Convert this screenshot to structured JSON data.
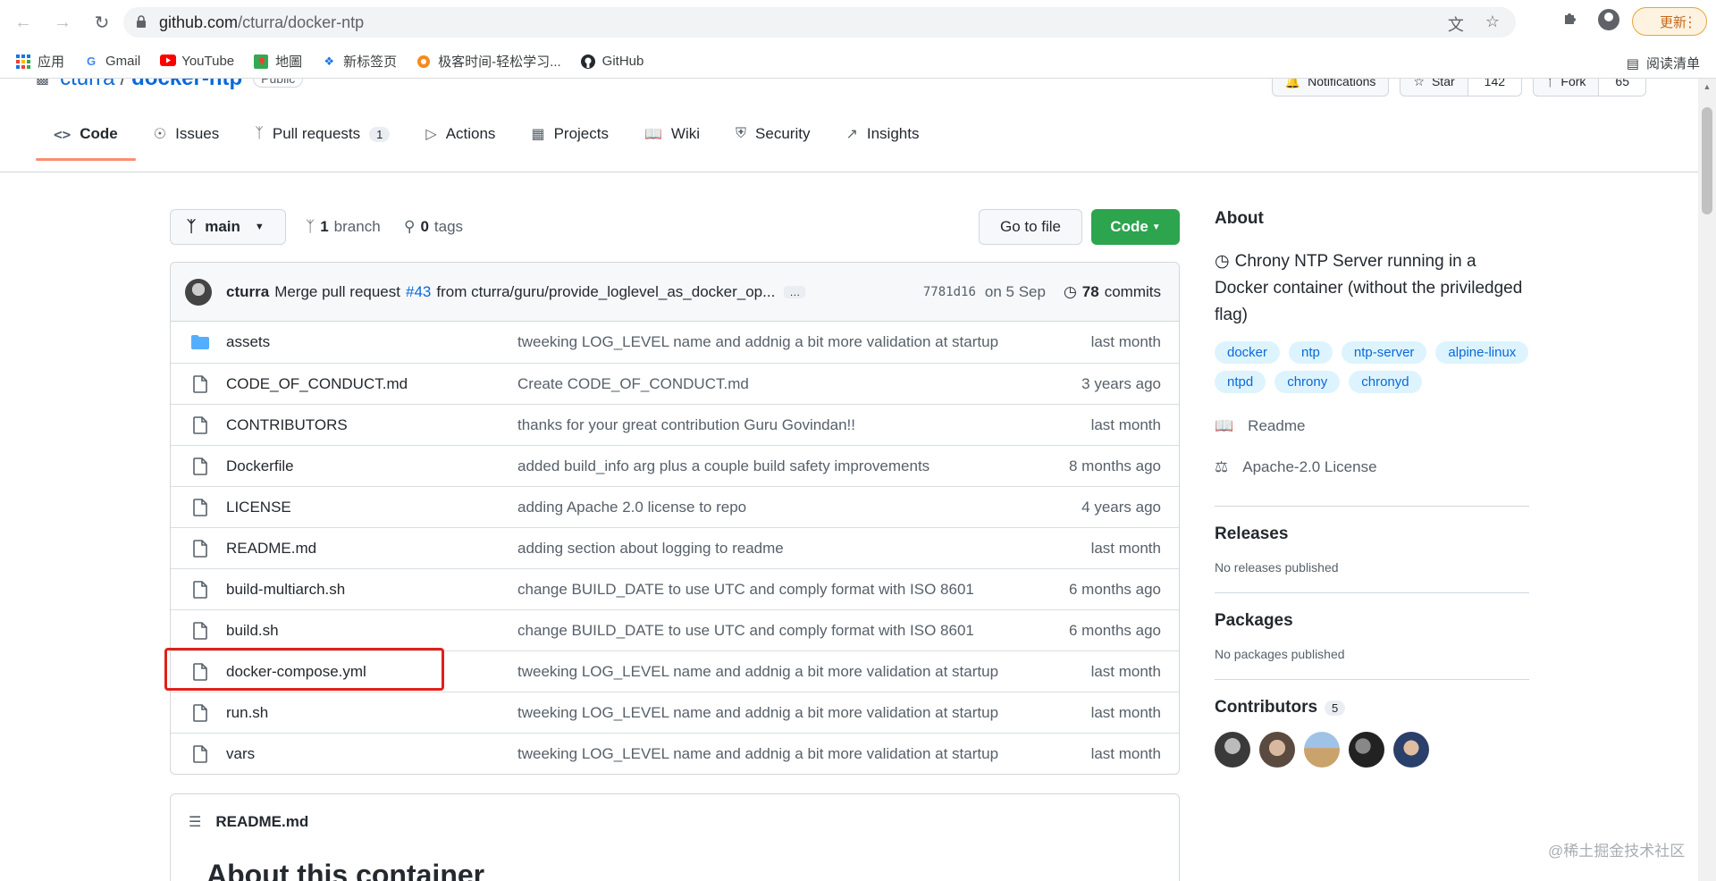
{
  "browser": {
    "url_host": "github.com",
    "url_path": "/cturra/docker-ntp",
    "update_label": "更新",
    "reading_list_label": "阅读清单",
    "bookmarks": [
      {
        "label": "应用",
        "icon": "apps-grid-icon"
      },
      {
        "label": "Gmail",
        "icon": "google-icon"
      },
      {
        "label": "YouTube",
        "icon": "youtube-icon"
      },
      {
        "label": "地圖",
        "icon": "maps-icon"
      },
      {
        "label": "新标签页",
        "icon": "new-tab-icon"
      },
      {
        "label": "极客时间-轻松学习...",
        "icon": "geektime-icon"
      },
      {
        "label": "GitHub",
        "icon": "github-icon"
      }
    ]
  },
  "repo": {
    "owner": "cturra",
    "separator": "/",
    "name": "docker-ntp",
    "visibility": "Public",
    "notifications_label": "Notifications",
    "star_label": "Star",
    "star_count": "142",
    "fork_label": "Fork",
    "fork_count": "65"
  },
  "tabs": [
    {
      "label": "Code",
      "icon": "code-icon",
      "active": true
    },
    {
      "label": "Issues",
      "icon": "issue-icon"
    },
    {
      "label": "Pull requests",
      "icon": "pull-request-icon",
      "counter": "1"
    },
    {
      "label": "Actions",
      "icon": "play-icon"
    },
    {
      "label": "Projects",
      "icon": "project-icon"
    },
    {
      "label": "Wiki",
      "icon": "book-icon"
    },
    {
      "label": "Security",
      "icon": "shield-icon"
    },
    {
      "label": "Insights",
      "icon": "graph-icon"
    }
  ],
  "file_nav": {
    "branch": "main",
    "branch_count": "1",
    "branch_label": "branch",
    "tag_count": "0",
    "tag_label": "tags",
    "goto_file": "Go to file",
    "code_btn": "Code"
  },
  "latest_commit": {
    "author": "cturra",
    "message_prefix": "Merge pull request",
    "pr_link": "#43",
    "message_suffix": "from cturra/guru/provide_loglevel_as_docker_op...",
    "ellipsis": "…",
    "sha": "7781d16",
    "date": "on 5 Sep",
    "commit_count": "78",
    "commit_label": "commits"
  },
  "files": [
    {
      "name": "assets",
      "type": "dir",
      "message": "tweeking LOG_LEVEL name and addnig a bit more validation at startup",
      "age": "last month"
    },
    {
      "name": "CODE_OF_CONDUCT.md",
      "type": "file",
      "message": "Create CODE_OF_CONDUCT.md",
      "age": "3 years ago"
    },
    {
      "name": "CONTRIBUTORS",
      "type": "file",
      "message": "thanks for your great contribution Guru Govindan!!",
      "age": "last month"
    },
    {
      "name": "Dockerfile",
      "type": "file",
      "message": "added build_info arg plus a couple build safety improvements",
      "age": "8 months ago"
    },
    {
      "name": "LICENSE",
      "type": "file",
      "message": "adding Apache 2.0 license to repo",
      "age": "4 years ago"
    },
    {
      "name": "README.md",
      "type": "file",
      "message": "adding section about logging to readme",
      "age": "last month"
    },
    {
      "name": "build-multiarch.sh",
      "type": "file",
      "message": "change BUILD_DATE to use UTC and comply format with ISO 8601",
      "age": "6 months ago"
    },
    {
      "name": "build.sh",
      "type": "file",
      "message": "change BUILD_DATE to use UTC and comply format with ISO 8601",
      "age": "6 months ago"
    },
    {
      "name": "docker-compose.yml",
      "type": "file",
      "message": "tweeking LOG_LEVEL name and addnig a bit more validation at startup",
      "age": "last month"
    },
    {
      "name": "run.sh",
      "type": "file",
      "message": "tweeking LOG_LEVEL name and addnig a bit more validation at startup",
      "age": "last month"
    },
    {
      "name": "vars",
      "type": "file",
      "message": "tweeking LOG_LEVEL name and addnig a bit more validation at startup",
      "age": "last month"
    }
  ],
  "readme": {
    "filename": "README.md",
    "heading": "About this container"
  },
  "sidebar": {
    "about_title": "About",
    "description": "Chrony NTP Server running in a Docker container (without the priviledged flag)",
    "topics": [
      "docker",
      "ntp",
      "ntp-server",
      "alpine-linux",
      "ntpd",
      "chrony",
      "chronyd"
    ],
    "readme_link": "Readme",
    "license_link": "Apache-2.0 License",
    "releases_title": "Releases",
    "releases_empty": "No releases published",
    "packages_title": "Packages",
    "packages_empty": "No packages published",
    "contributors_title": "Contributors",
    "contributors_count": "5"
  },
  "watermark": "@稀土掘金技术社区",
  "colors": {
    "accent_blue": "#0969da",
    "code_button_green": "#2da44e",
    "active_tab_underline": "#fd8c73",
    "highlight_red": "#e0201a",
    "folder_blue": "#54aeff"
  }
}
